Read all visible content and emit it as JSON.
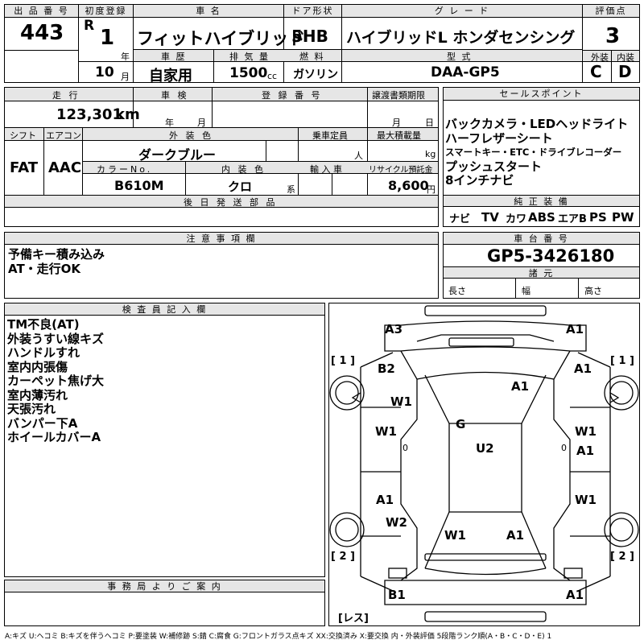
{
  "header": {
    "lot_label": "出 品 番 号",
    "lot": "443",
    "first_reg_label": "初度登録",
    "era": "R",
    "year": "1",
    "year_unit": "年",
    "month": "10",
    "month_unit": "月",
    "car_name_label": "車 名",
    "car_name": "フィットハイブリッド",
    "history_label": "車 歴",
    "history": "自家用",
    "displacement_label": "排 気 量",
    "displacement": "1500",
    "cc": "cc",
    "door_label": "ドア形状",
    "door": "5HB",
    "fuel_label": "燃 料",
    "fuel": "ガソリン",
    "grade_label": "グ レ ー ド",
    "grade": "ハイブリッドL ホンダセンシング",
    "model_label": "型 式",
    "model": "DAA-GP5",
    "score_label": "評価点",
    "score": "3",
    "ext_label": "外装",
    "ext": "C",
    "int_label": "内装",
    "int": "D"
  },
  "row2": {
    "mileage_label": "走 行",
    "mileage": "123,301",
    "km": "km",
    "inspection_label": "車 検",
    "insp_year": "年",
    "insp_month": "月",
    "reg_label": "登 録 番 号",
    "transfer_label": "譲渡書類期限",
    "tr_month": "月",
    "tr_day": "日",
    "shift_label": "シフト",
    "shift": "FAT",
    "ac_label": "エアコン",
    "ac": "AAC",
    "color_label": "外 装 色",
    "color": "ダークブルー",
    "capacity_label": "乗車定員",
    "capacity_unit": "人",
    "load_label": "最大積載量",
    "load_unit": "kg",
    "color_no_label": "カラーNo.",
    "color_no": "B610M",
    "interior_label": "内 装 色",
    "interior": "クロ",
    "interior_unit": "系",
    "import_label": "輸 入 車",
    "recycle_label": "リサイクル預託金",
    "recycle": "8,600",
    "yen": "円",
    "later_label": "後 日 発 送 部 品"
  },
  "sales": {
    "label": "セールスポイント",
    "lines": [
      "バックカメラ・LEDヘッドライト",
      "ハーフレザーシート",
      "スマートキー・ETC・ドライブレコーダー",
      "プッシュスタート",
      "8インチナビ"
    ],
    "equip_label": "純 正 装 備",
    "equip": [
      "ナビ",
      "TV",
      "カワ",
      "ABS",
      "エアB",
      "PS",
      "PW"
    ]
  },
  "notes": {
    "label": "注 意 事 項 欄",
    "lines": [
      "予備キー積み込み",
      "AT・走行OK"
    ]
  },
  "chassis": {
    "label": "車 台 番 号",
    "value": "GP5-3426180",
    "dims_label": "諸 元",
    "length": "長さ",
    "width": "幅",
    "height": "高さ"
  },
  "inspector": {
    "label": "検 査 員 記 入 欄",
    "lines": [
      "TM不良(AT)",
      "外装うすい線キズ",
      "ハンドルすれ",
      "室内内張傷",
      "カーペット焦げ大",
      "室内薄汚れ",
      "天張汚れ",
      "バンパー下A",
      "ホイールカバーA"
    ]
  },
  "office": {
    "label": "事 務 局 よ り ご 案 内"
  },
  "diagram": {
    "marks": [
      "A3",
      "A1",
      "B2",
      "A1",
      "W1",
      "A1",
      "G",
      "W1",
      "W1",
      "U2",
      "A1",
      "A1",
      "A1",
      "W1",
      "W2",
      "W1",
      "A1",
      "B1",
      "A1"
    ],
    "side1": "[ 1 ]",
    "side2": "[ 2 ]",
    "rest": "[レス]",
    "zero": "0"
  },
  "legend": "A:キズ U:ヘコミ B:キズを伴うヘコミ P:要塗装 W:補修跡 S:錆 C:腐食 G:フロントガラス点キズ XX:交換済み X:要交換 内・外装評価 5段階ランク順(A・B・C・D・E) 1"
}
